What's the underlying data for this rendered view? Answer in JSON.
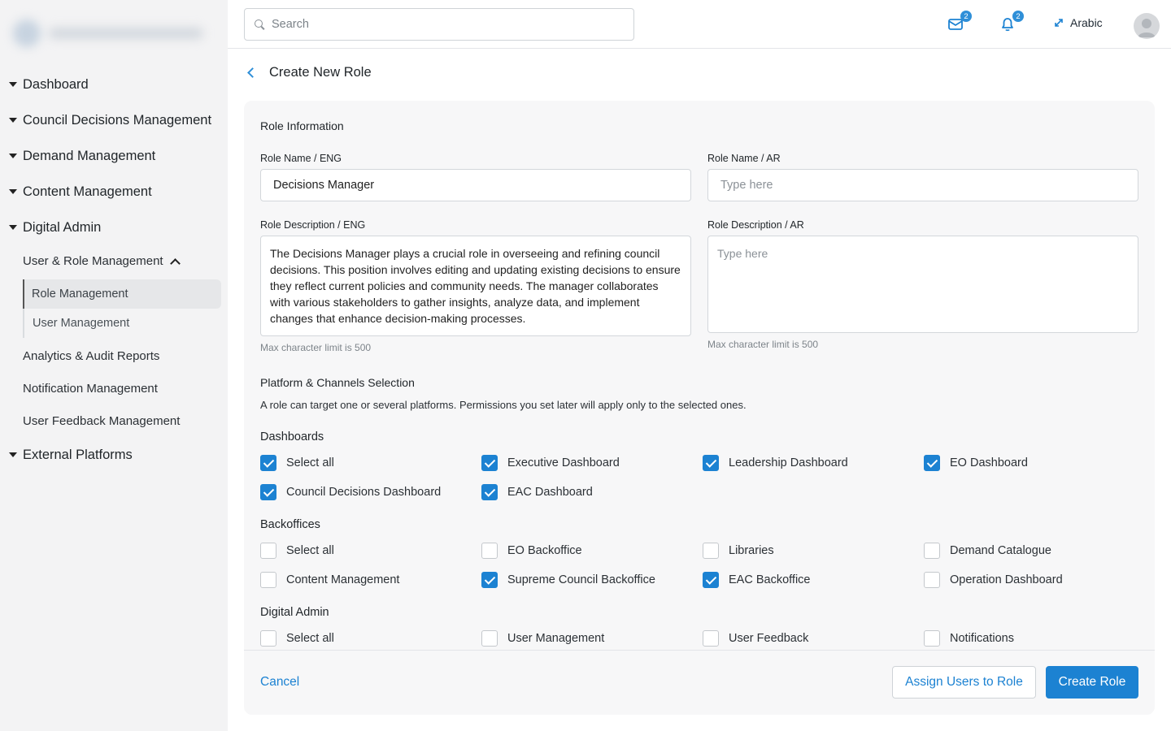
{
  "sidebar": {
    "top_items": [
      {
        "label": "Dashboard"
      },
      {
        "label": "Council Decisions Management"
      },
      {
        "label": "Demand Management"
      },
      {
        "label": "Content Management"
      },
      {
        "label": "Digital Admin"
      },
      {
        "label": "External Platforms"
      }
    ],
    "digital_admin": {
      "user_role": "User & Role Management",
      "role_management": "Role Management",
      "user_management": "User Management",
      "analytics": "Analytics & Audit Reports",
      "notification": "Notification Management",
      "feedback": "User Feedback Management"
    }
  },
  "header": {
    "search_placeholder": "Search",
    "messages_count": "2",
    "notifications_count": "2",
    "language": "Arabic"
  },
  "page": {
    "title": "Create New Role"
  },
  "role_info": {
    "title": "Role Information",
    "name_en_label": "Role Name / ENG",
    "name_en_value": "Decisions Manager",
    "name_ar_label": "Role Name / AR",
    "name_ar_placeholder": "Type here",
    "desc_en_label": "Role Description / ENG",
    "desc_en_value": "The Decisions Manager plays a crucial role in overseeing and refining council decisions. This position involves editing and updating existing decisions to ensure they reflect current policies and community needs. The manager collaborates with various stakeholders to gather insights, analyze data, and implement changes that enhance decision-making processes.",
    "desc_ar_label": "Role Description / AR",
    "desc_ar_placeholder": "Type here",
    "limit_hint_en": "Max character limit is 500",
    "limit_hint_ar": "Max character limit is 500"
  },
  "platforms": {
    "title": "Platform & Channels Selection",
    "description": "A role can target one or several platforms. Permissions you set later will apply only to the selected ones.",
    "groups": [
      {
        "title": "Dashboards",
        "options": [
          {
            "label": "Select all",
            "checked": true
          },
          {
            "label": "Executive Dashboard",
            "checked": true
          },
          {
            "label": "Leadership Dashboard",
            "checked": true
          },
          {
            "label": "EO Dashboard",
            "checked": true
          },
          {
            "label": "Council Decisions Dashboard",
            "checked": true
          },
          {
            "label": "EAC Dashboard",
            "checked": true
          }
        ]
      },
      {
        "title": "Backoffices",
        "options": [
          {
            "label": "Select all",
            "checked": false
          },
          {
            "label": "EO Backoffice",
            "checked": false
          },
          {
            "label": "Libraries",
            "checked": false
          },
          {
            "label": "Demand Catalogue",
            "checked": false
          },
          {
            "label": "Content Management",
            "checked": false
          },
          {
            "label": "Supreme Council Backoffice",
            "checked": true
          },
          {
            "label": "EAC Backoffice",
            "checked": true
          },
          {
            "label": "Operation Dashboard",
            "checked": false
          }
        ]
      },
      {
        "title": "Digital Admin",
        "options": [
          {
            "label": "Select all",
            "checked": false
          },
          {
            "label": "User Management",
            "checked": false
          },
          {
            "label": "User Feedback",
            "checked": false
          },
          {
            "label": "Notifications",
            "checked": false
          }
        ]
      }
    ]
  },
  "footer": {
    "cancel": "Cancel",
    "assign": "Assign Users to Role",
    "create": "Create Role"
  },
  "colors": {
    "accent": "#1c82d2",
    "sidebar_bg": "#f3f3f4",
    "card_bg": "#f7f7f8"
  }
}
